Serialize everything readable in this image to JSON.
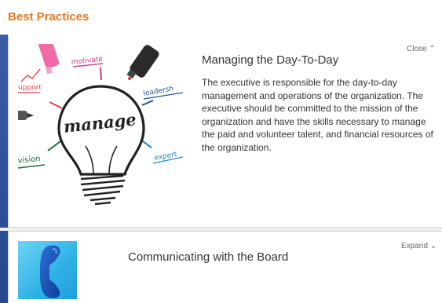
{
  "header": {
    "title": "Best Practices"
  },
  "cards": [
    {
      "title": "Managing the Day-To-Day",
      "toggle_label": "Close",
      "toggle_icon": "chevron-up-icon",
      "body": "The executive is responsible for the day-to-day management and operations of the organization. The executive should be committed to the mission of the organization and have the skills necessary to manage the paid and volunteer talent, and financial resources of the organization.",
      "image_words": {
        "center": "manage",
        "top": "motivate",
        "left_top": "upport",
        "right": "leadersh",
        "left": "vision",
        "right_bottom": "expert"
      }
    },
    {
      "title": "Communicating with the Board",
      "toggle_label": "Expand",
      "toggle_icon": "chevron-down-icon"
    }
  ],
  "colors": {
    "accent": "#e8771e",
    "phone_blue": "#1552b8",
    "sky": "#2fb1e6"
  }
}
